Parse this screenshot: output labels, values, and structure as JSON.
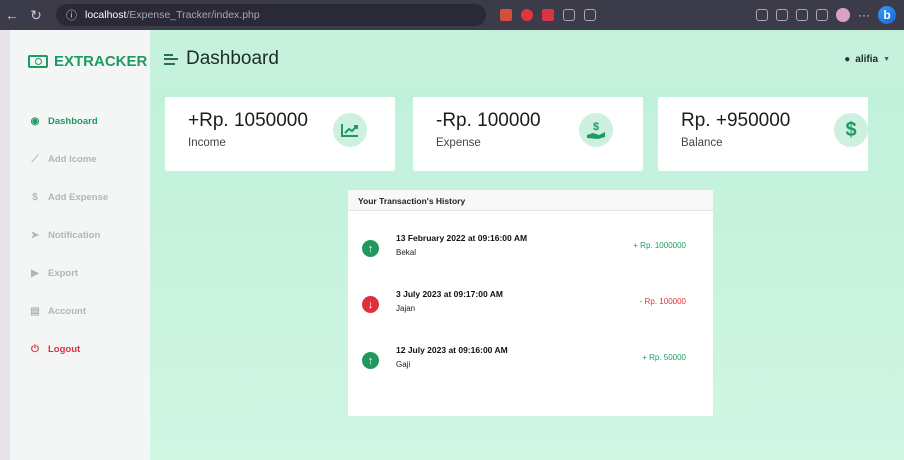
{
  "browser": {
    "url_host": "localhost",
    "url_path": "/Expense_Tracker/index.php"
  },
  "sidebar": {
    "brand": "EXTRACKER",
    "items": [
      {
        "label": "Dashboard",
        "icon": "gauge-icon"
      },
      {
        "label": "Add Icome",
        "icon": "chart-icon"
      },
      {
        "label": "Add Expense",
        "icon": "hand-dollar-icon"
      },
      {
        "label": "Notification",
        "icon": "paper-plane-icon"
      },
      {
        "label": "Export",
        "icon": "file-export-icon"
      },
      {
        "label": "Account",
        "icon": "id-card-icon"
      },
      {
        "label": "Logout",
        "icon": "power-icon"
      }
    ]
  },
  "header": {
    "title": "Dashboard",
    "user": "alifia"
  },
  "cards": [
    {
      "amount": "+Rp. 1050000",
      "label": "Income",
      "icon": "chart-line-icon"
    },
    {
      "amount": "-Rp. 100000",
      "label": "Expense",
      "icon": "hand-dollar-icon"
    },
    {
      "amount": "Rp. +950000",
      "label": "Balance",
      "icon": "dollar-icon"
    }
  ],
  "history": {
    "title": "Your Transaction's History",
    "transactions": [
      {
        "date": "13 February 2022 at 09:16:00 AM",
        "note": "Bekal",
        "value": "+ Rp. 1000000",
        "direction": "up"
      },
      {
        "date": "3 July 2023 at 09:17:00 AM",
        "note": "Jajan",
        "value": "- Rp. 100000",
        "direction": "down"
      },
      {
        "date": "12 July 2023 at 09:16:00 AM",
        "note": "Gaji",
        "value": "+ Rp. 50000",
        "direction": "up"
      }
    ]
  },
  "colors": {
    "brand": "#1e9a64",
    "logout": "#d9304a",
    "positive": "#1f9a5e",
    "negative": "#e0303a"
  }
}
